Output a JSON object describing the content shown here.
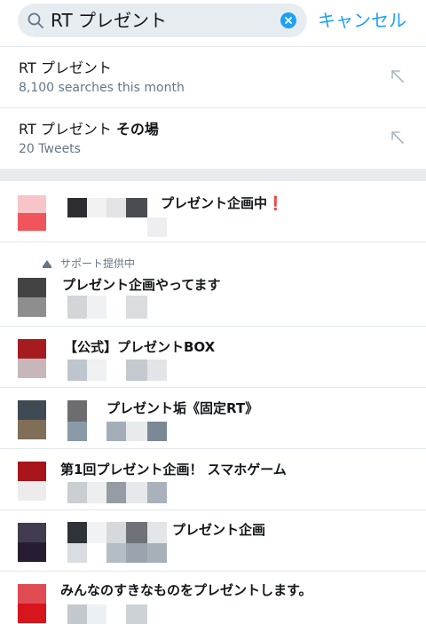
{
  "search": {
    "query": "RT プレゼント",
    "cancel_label": "キャンセル"
  },
  "suggestions": [
    {
      "title_plain": "RT プレゼント",
      "title_bold": "",
      "subtitle": "8,100 searches this month"
    },
    {
      "title_plain": "RT プレゼント ",
      "title_bold": "その場",
      "subtitle": "20 Tweets"
    }
  ],
  "promoted_label": "サポート提供中",
  "accounts": [
    {
      "name": "プレゼント企画中",
      "badge": "❗",
      "promoted": false
    },
    {
      "name": "プレゼント企画やってます",
      "badge": "",
      "promoted": true
    },
    {
      "name": "【公式】プレゼントBOX",
      "badge": "",
      "promoted": false
    },
    {
      "name": "プレゼント垢《固定RT》",
      "badge": "",
      "promoted": false
    },
    {
      "name": "第1回プレゼント企画！ スマホゲーム",
      "badge": "",
      "promoted": false
    },
    {
      "name": "プレゼント企画",
      "badge": "",
      "promoted": false
    },
    {
      "name": "みんなのすきなものをプレゼントします。",
      "badge": "",
      "promoted": false
    }
  ],
  "colors": {
    "accent": "#1da1f2",
    "secondary_text": "#657786",
    "search_bg": "#e6ecf0",
    "divider": "#e1e8ed"
  }
}
